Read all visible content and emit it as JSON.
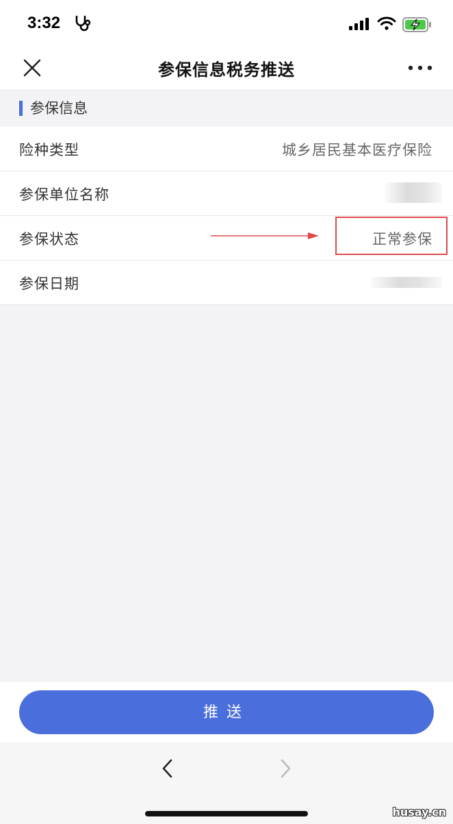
{
  "status_bar": {
    "time": "3:32",
    "icons": [
      "stethoscope-icon",
      "signal-icon",
      "wifi-icon",
      "battery-charging-icon"
    ]
  },
  "nav": {
    "title": "参保信息税务推送",
    "close_icon": "close-icon",
    "more_icon": "more-icon"
  },
  "section": {
    "title": "参保信息",
    "accent_color": "#4a6fdc"
  },
  "rows": [
    {
      "label": "险种类型",
      "value": "城乡居民基本医疗保险"
    },
    {
      "label": "参保单位名称",
      "value": ""
    },
    {
      "label": "参保状态",
      "value": "正常参保"
    },
    {
      "label": "参保日期",
      "value": ""
    }
  ],
  "annotation": {
    "color": "#e0484a"
  },
  "actions": {
    "push_label": "推送",
    "button_color": "#4a6fdc"
  },
  "browser": {
    "back_icon": "chevron-left-icon",
    "forward_icon": "chevron-right-icon"
  },
  "watermark": "husay.cn"
}
